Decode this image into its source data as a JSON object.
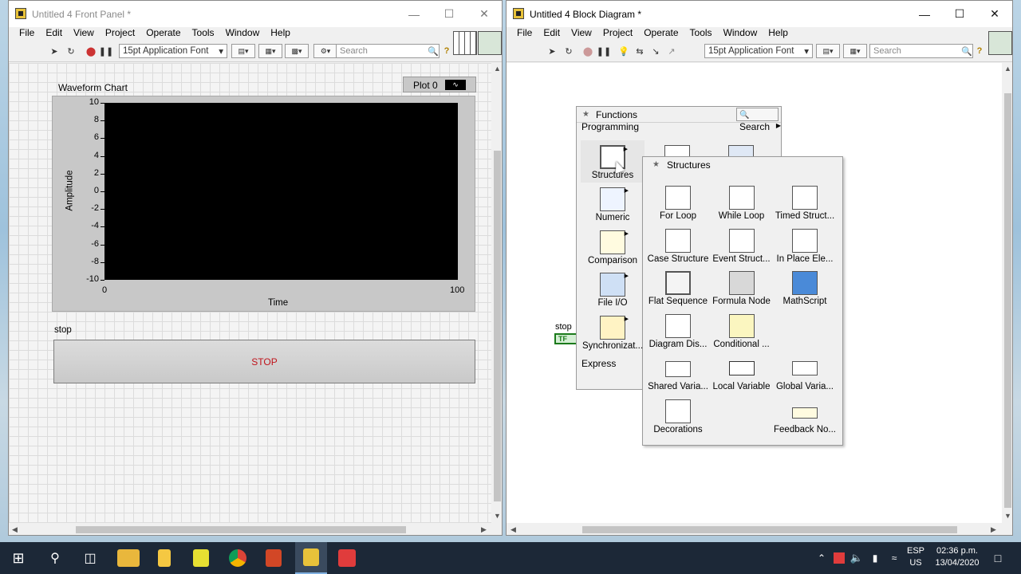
{
  "front_panel": {
    "title": "Untitled 4 Front Panel *",
    "menu": [
      "File",
      "Edit",
      "View",
      "Project",
      "Operate",
      "Tools",
      "Window",
      "Help"
    ],
    "font_selector": "15pt Application Font",
    "search_placeholder": "Search",
    "chart": {
      "label": "Waveform Chart",
      "plot_legend": "Plot 0",
      "y_axis_label": "Amplitude",
      "x_axis_label": "Time",
      "y_ticks": [
        "10",
        "8",
        "6",
        "4",
        "2",
        "0",
        "-2",
        "-4",
        "-6",
        "-8",
        "-10"
      ],
      "x_ticks": [
        "0",
        "100"
      ]
    },
    "stop_label": "stop",
    "stop_button_text": "STOP"
  },
  "block_diagram": {
    "title": "Untitled 4 Block Diagram *",
    "menu": [
      "File",
      "Edit",
      "View",
      "Project",
      "Operate",
      "Tools",
      "Window",
      "Help"
    ],
    "font_selector": "15pt Application Font",
    "search_placeholder": "Search",
    "stop_terminal_label": "stop",
    "stop_terminal_text": "TF"
  },
  "functions_palette": {
    "title": "Functions",
    "search_button": "Search",
    "category": "Programming",
    "items": [
      "Structures",
      "Numeric",
      "Comparison",
      "File I/O",
      "Synchronizat..."
    ],
    "bottom_category": "Express"
  },
  "structures_palette": {
    "title": "Structures",
    "items": [
      "For Loop",
      "While Loop",
      "Timed Struct...",
      "Case Structure",
      "Event Struct...",
      "In Place Ele...",
      "Flat Sequence",
      "Formula Node",
      "MathScript",
      "Diagram Dis...",
      "Conditional ...",
      "Shared Varia...",
      "Local Variable",
      "Global Varia...",
      "Decorations",
      "Feedback No..."
    ]
  },
  "taskbar": {
    "lang_1": "ESP",
    "lang_2": "US",
    "time": "02:36 p.m.",
    "date": "13/04/2020"
  }
}
